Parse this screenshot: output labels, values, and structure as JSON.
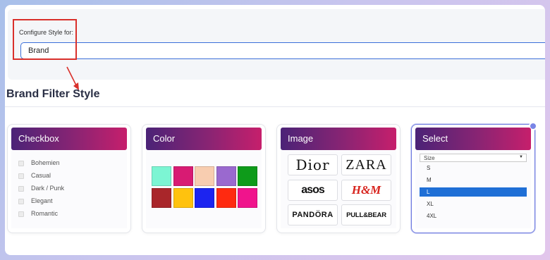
{
  "config": {
    "label": "Configure Style for:",
    "value": "Brand"
  },
  "section_title": "Brand Filter Style",
  "cards": {
    "checkbox": {
      "title": "Checkbox",
      "items": [
        "Bohemien",
        "Casual",
        "Dark / Punk",
        "Elegant",
        "Romantic"
      ]
    },
    "color": {
      "title": "Color",
      "swatches": [
        "#7cf5d3",
        "#d81b73",
        "#f8cdb0",
        "#9a69cf",
        "#0e9b1a",
        "#a9262a",
        "#ffc20e",
        "#1c24f0",
        "#ff2a10",
        "#f0148c"
      ]
    },
    "image": {
      "title": "Image",
      "logos": [
        "Dior",
        "ZARA",
        "asos",
        "H&M",
        "PANDÖRA",
        "PULL&BEAR"
      ]
    },
    "select": {
      "title": "Select",
      "placeholder": "Size",
      "options": [
        "S",
        "M",
        "L",
        "XL",
        "4XL"
      ],
      "selected": "L"
    }
  },
  "colors": {
    "accent_border": "#3b6fd9",
    "highlight": "#d9302b",
    "header_gradient_start": "#4b2377",
    "header_gradient_end": "#c61f6c",
    "select_highlight": "#1f6fd6"
  }
}
